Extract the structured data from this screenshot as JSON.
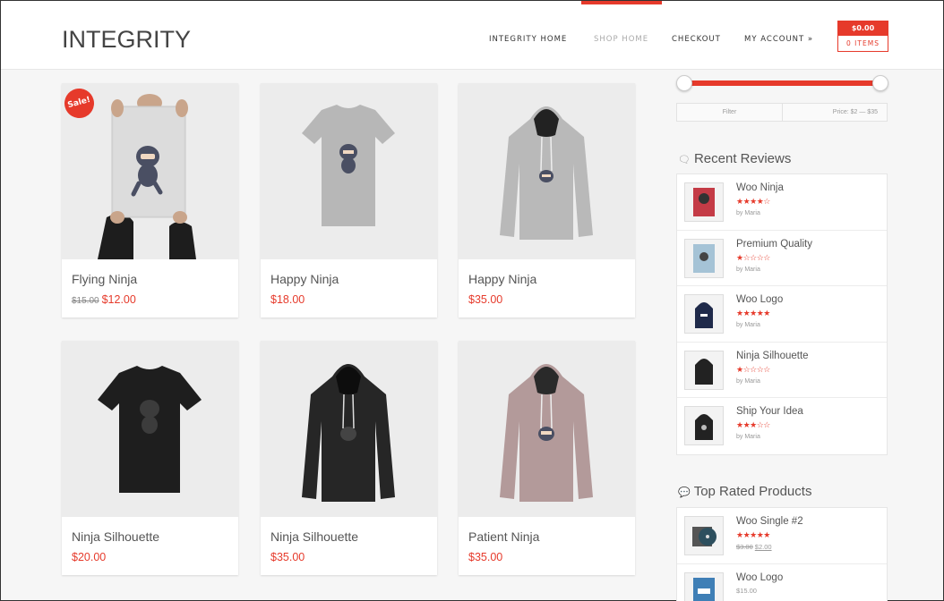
{
  "header": {
    "logo": "INTEGRITY",
    "nav": [
      "INTEGRITY HOME",
      "SHOP HOME",
      "CHECKOUT",
      "MY ACCOUNT »"
    ],
    "cart_total": "$0.00",
    "cart_items": "0 ITEMS"
  },
  "products": [
    {
      "name": "Flying Ninja",
      "old_price": "$15.00",
      "price": "$12.00",
      "sale_badge": "Sale!",
      "image": "poster"
    },
    {
      "name": "Happy Ninja",
      "price": "$18.00",
      "image": "tshirt-grey"
    },
    {
      "name": "Happy Ninja",
      "price": "$35.00",
      "image": "hoodie-grey"
    },
    {
      "name": "Ninja Silhouette",
      "price": "$20.00",
      "image": "tshirt-black"
    },
    {
      "name": "Ninja Silhouette",
      "price": "$35.00",
      "image": "hoodie-black"
    },
    {
      "name": "Patient Ninja",
      "price": "$35.00",
      "image": "hoodie-pink"
    }
  ],
  "filter": {
    "button": "Filter",
    "price_label": "Price: $2 — $35"
  },
  "recent_reviews": {
    "title": "Recent Reviews",
    "icon": "comments-icon",
    "items": [
      {
        "name": "Woo Ninja",
        "stars": "★★★★☆",
        "by": "by Maria",
        "thumb": "poster-red"
      },
      {
        "name": "Premium Quality",
        "stars": "★☆☆☆☆",
        "by": "by Maria",
        "thumb": "poster-blue"
      },
      {
        "name": "Woo Logo",
        "stars": "★★★★★",
        "by": "by Maria",
        "thumb": "hoodie-navy"
      },
      {
        "name": "Ninja Silhouette",
        "stars": "★☆☆☆☆",
        "by": "by Maria",
        "thumb": "hoodie-black"
      },
      {
        "name": "Ship Your Idea",
        "stars": "★★★☆☆",
        "by": "by Maria",
        "thumb": "hoodie-black"
      }
    ]
  },
  "top_rated": {
    "title": "Top Rated Products",
    "icon": "comment-icon",
    "items": [
      {
        "name": "Woo Single #2",
        "stars": "★★★★★",
        "old_price": "$3.00",
        "price": "$2.00",
        "thumb": "cd"
      },
      {
        "name": "Woo Logo",
        "price": "$15.00",
        "thumb": "poster-blue"
      }
    ]
  },
  "colors": {
    "accent": "#e63a2b"
  }
}
